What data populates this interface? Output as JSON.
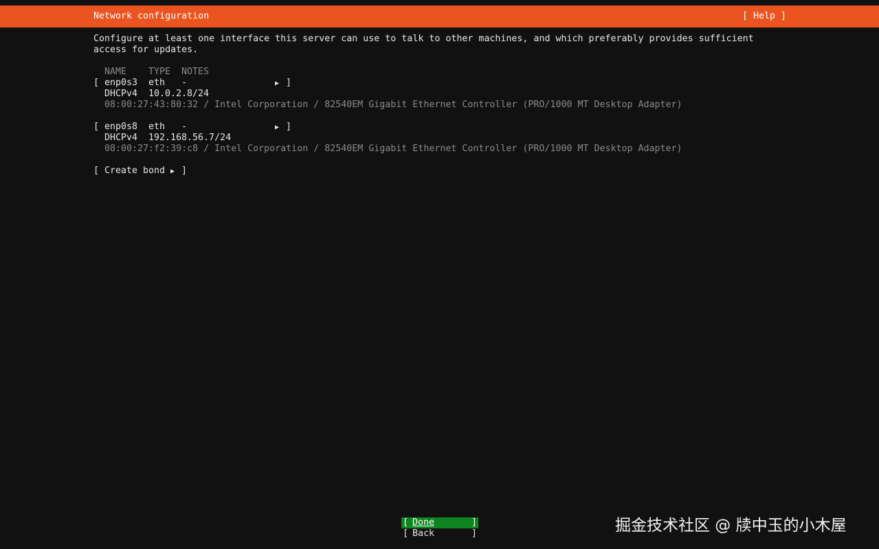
{
  "header": {
    "title": "Network configuration",
    "help_label": "[ Help ]",
    "accent_color": "#e95420"
  },
  "description": {
    "line1": "Configure at least one interface this server can use to talk to other machines, and which preferably provides sufficient",
    "line2": "access for updates."
  },
  "table": {
    "columns": [
      "NAME",
      "TYPE",
      "NOTES"
    ],
    "interfaces": [
      {
        "name": "enp0s3",
        "type": "eth",
        "notes": "-",
        "address_method": "DHCPv4",
        "address": "10.0.2.8/24",
        "hardware": "08:00:27:43:80:32 / Intel Corporation / 82540EM Gigabit Ethernet Controller (PRO/1000 MT Desktop Adapter)"
      },
      {
        "name": "enp0s8",
        "type": "eth",
        "notes": "-",
        "address_method": "DHCPv4",
        "address": "192.168.56.7/24",
        "hardware": "08:00:27:f2:39:c8 / Intel Corporation / 82540EM Gigabit Ethernet Controller (PRO/1000 MT Desktop Adapter)"
      }
    ],
    "open_bracket": "[",
    "close_bracket": "]",
    "expand_icon": "right-triangle-icon"
  },
  "create_bond": {
    "label": "Create bond"
  },
  "footer": {
    "done_label": "Done",
    "back_label": "Back",
    "done_color": "#0e8420"
  },
  "watermark": {
    "text": "掘金技术社区 @ 牍中玉的小木屋"
  }
}
